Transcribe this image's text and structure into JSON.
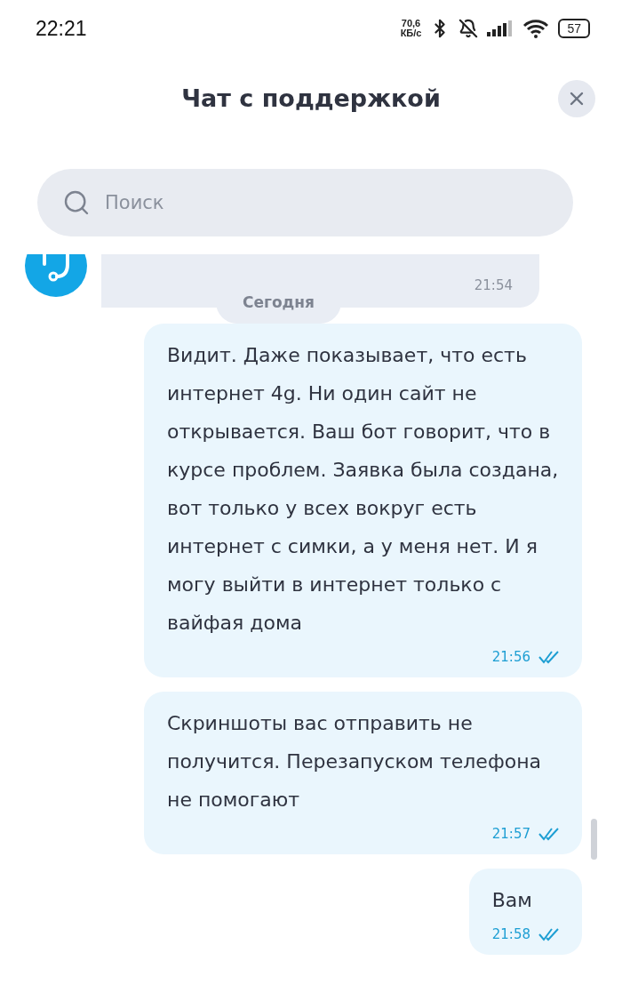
{
  "status_bar": {
    "time": "22:21",
    "speed_value": "70,6",
    "speed_unit": "КБ/с",
    "battery": "57"
  },
  "header": {
    "title": "Чат с поддержкой"
  },
  "search": {
    "placeholder": "Поиск"
  },
  "messages": [
    {
      "kind": "incoming",
      "time": "21:54"
    },
    {
      "kind": "date",
      "text": "Сегодня"
    },
    {
      "kind": "outgoing",
      "text": "Видит. Даже показывает, что есть интернет 4g. Ни один сайт не открывается. Ваш бот говорит, что в курсе проблем. Заявка была создана, вот только у всех вокруг есть интернет с симки, а у меня нет. И я могу выйти в интернет только с вайфая дома",
      "time": "21:56",
      "read": true
    },
    {
      "kind": "outgoing",
      "text": "Скриншоты вас отправить не получится. Перезапуском телефона не помогают",
      "time": "21:57",
      "read": true
    },
    {
      "kind": "outgoing",
      "text": "Вам",
      "time": "21:58",
      "read": true
    }
  ]
}
